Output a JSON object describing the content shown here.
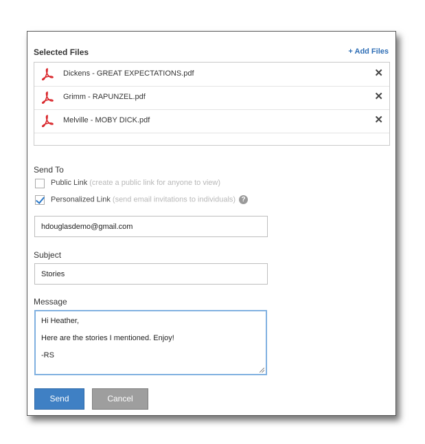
{
  "files_section": {
    "title": "Selected Files",
    "add_files_label": "+ Add Files",
    "files": [
      {
        "name": "Dickens - GREAT EXPECTATIONS.pdf",
        "icon": "pdf-icon"
      },
      {
        "name": "Grimm - RAPUNZEL.pdf",
        "icon": "pdf-icon"
      },
      {
        "name": "Melville - MOBY DICK.pdf",
        "icon": "pdf-icon"
      }
    ],
    "remove_glyph": "✕"
  },
  "send_to": {
    "label": "Send To",
    "public_link": {
      "label": "Public Link",
      "hint": "(create a public link for anyone to view)",
      "checked": false
    },
    "personalized_link": {
      "label": "Personalized Link",
      "hint": "(send email invitations to individuals)",
      "checked": true
    },
    "help_glyph": "?"
  },
  "recipient": {
    "value": "hdouglasdemo@gmail.com"
  },
  "subject": {
    "label": "Subject",
    "value": "Stories"
  },
  "message": {
    "label": "Message",
    "lines": [
      "Hi Heather,",
      "Here are the stories I mentioned. Enjoy!",
      "-RS"
    ]
  },
  "buttons": {
    "send": "Send",
    "cancel": "Cancel"
  },
  "colors": {
    "accent": "#3f80c4",
    "link": "#2d6db5",
    "pdf_red": "#d9262b",
    "focus_border": "#7fb0e0"
  }
}
